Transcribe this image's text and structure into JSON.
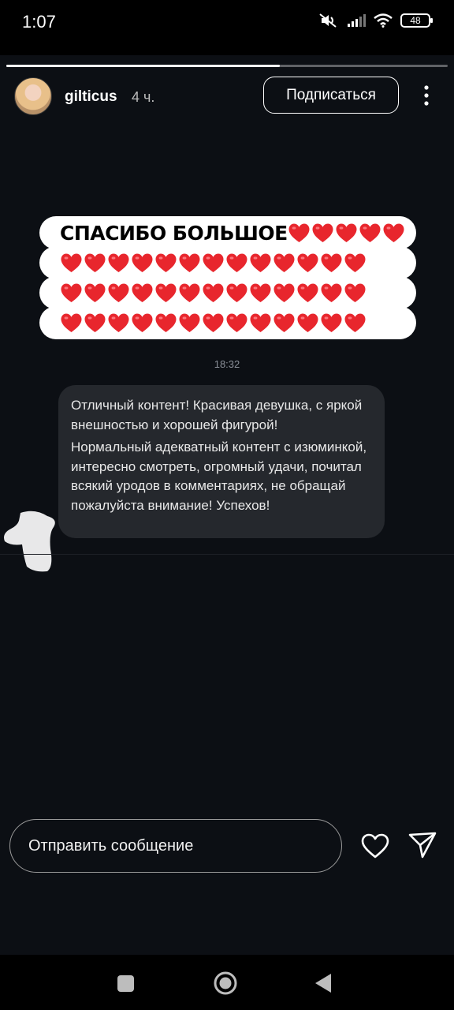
{
  "status_bar": {
    "time": "1:07",
    "battery": "48",
    "icons": [
      "mute-icon",
      "signal-icon",
      "wifi-icon",
      "battery-icon"
    ]
  },
  "story": {
    "progress": 0.62,
    "username": "gilticus",
    "posted_ago": "4 ч.",
    "subscribe_label": "Подписаться",
    "sticker": {
      "title": "СПАСИБО БОЛЬШОЕ",
      "heart_color": "#e8262d",
      "heart_count": 44
    },
    "message_time": "18:32",
    "message": {
      "paragraph_1": "Отличный контент! Красивая девушка, с яркой внешностью и хорошей фигурой!",
      "paragraph_2": "Нормальный адекватный контент с изюминкой, интересно смотреть, огромный удачи, почитал всякий уродов в комментариях, не обращай пожалуйста внимание! Успехов!"
    }
  },
  "reply": {
    "placeholder": "Отправить сообщение"
  },
  "colors": {
    "background": "#0c0f14",
    "bubble": "#25282d",
    "heart": "#e8262d"
  }
}
